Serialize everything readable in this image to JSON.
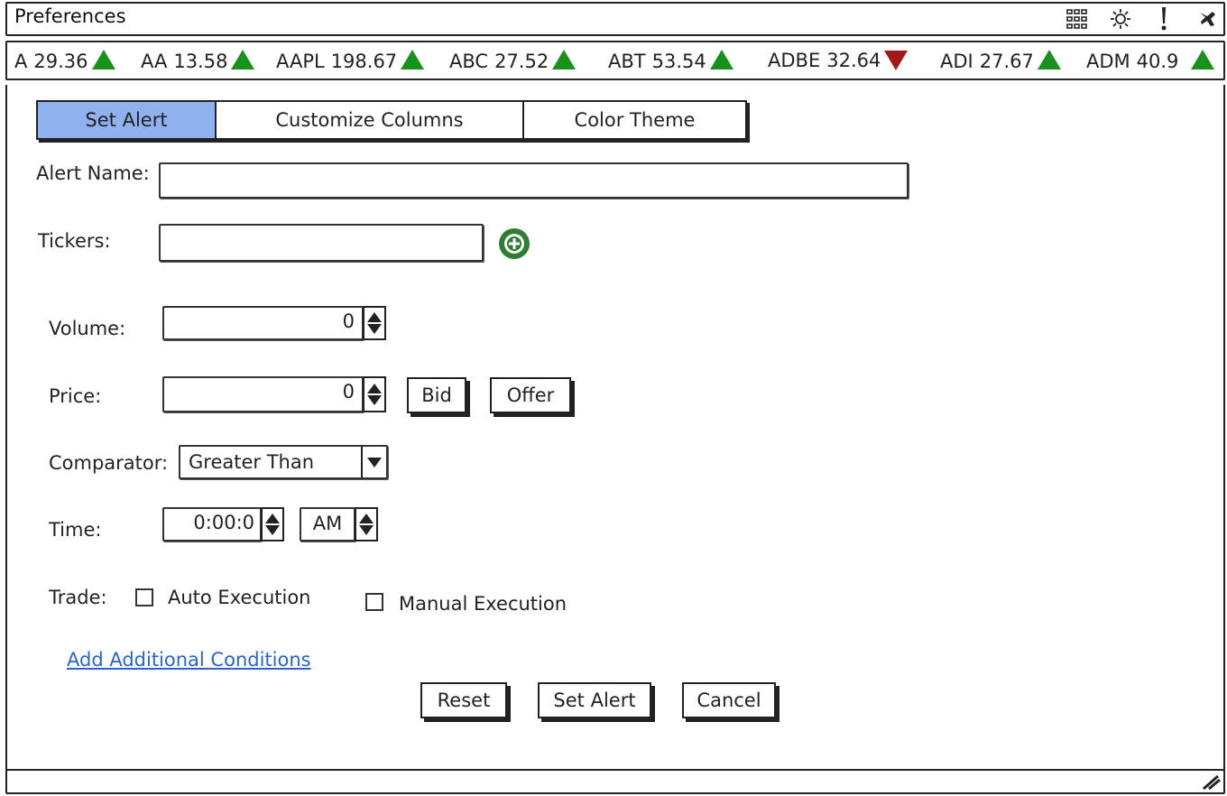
{
  "window": {
    "title": "Preferences"
  },
  "titlebar_icons": [
    "grid-icon",
    "gear-icon",
    "alert-icon",
    "pin-icon"
  ],
  "ticker": [
    {
      "symbol": "A",
      "price": "29.36",
      "dir": "up"
    },
    {
      "symbol": "AA",
      "price": "13.58",
      "dir": "up"
    },
    {
      "symbol": "AAPL",
      "price": "198.67",
      "dir": "up"
    },
    {
      "symbol": "ABC",
      "price": "27.52",
      "dir": "up"
    },
    {
      "symbol": "ABT",
      "price": "53.54",
      "dir": "up"
    },
    {
      "symbol": "ADBE",
      "price": "32.64",
      "dir": "down"
    },
    {
      "symbol": "ADI",
      "price": "27.67",
      "dir": "up"
    },
    {
      "symbol": "ADM",
      "price": "40.9",
      "dir": "up"
    }
  ],
  "colors": {
    "up": "#18921c",
    "down": "#a01818",
    "active_tab": "#8fb1ee",
    "link": "#2a64c4",
    "add_icon": "#2e7d32"
  },
  "tabs": [
    {
      "label": "Set Alert",
      "active": true
    },
    {
      "label": "Customize Columns",
      "active": false
    },
    {
      "label": "Color Theme",
      "active": false
    }
  ],
  "form": {
    "alert_name_label": "Alert Name:",
    "alert_name_value": "",
    "tickers_label": "Tickers:",
    "tickers_value": "",
    "volume_label": "Volume:",
    "volume_value": "0",
    "price_label": "Price:",
    "price_value": "0",
    "bid_label": "Bid",
    "offer_label": "Offer",
    "comparator_label": "Comparator:",
    "comparator_value": "Greater Than",
    "time_label": "Time:",
    "time_value": "0:00:0",
    "ampm_value": "AM",
    "trade_label": "Trade:",
    "auto_execution_label": "Auto Execution",
    "manual_execution_label": "Manual Execution",
    "add_conditions_link": "Add Additional Conditions"
  },
  "buttons": {
    "reset": "Reset",
    "set_alert": "Set Alert",
    "cancel": "Cancel"
  }
}
